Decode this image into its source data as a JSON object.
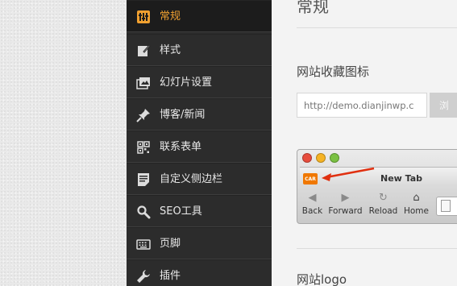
{
  "sidebar": {
    "items": [
      {
        "label": "常规",
        "icon": "general-settings-icon",
        "active": true
      },
      {
        "label": "样式",
        "icon": "edit-icon"
      },
      {
        "label": "幻灯片设置",
        "icon": "slideshow-icon"
      },
      {
        "label": "博客/新闻",
        "icon": "pin-icon"
      },
      {
        "label": "联系表单",
        "icon": "qr-grid-icon"
      },
      {
        "label": "自定义侧边栏",
        "icon": "document-icon"
      },
      {
        "label": "SEO工具",
        "icon": "search-icon"
      },
      {
        "label": "页脚",
        "icon": "keyboard-icon"
      },
      {
        "label": "插件",
        "icon": "wrench-icon"
      }
    ]
  },
  "main": {
    "section_title": "常规",
    "favicon_label": "网站收藏图标",
    "favicon_url_value": "http://demo.dianjinwp.c",
    "browse_label": "浏",
    "preview": {
      "tab_title": "New Tab",
      "favicon_text": "CAR",
      "toolbar": [
        {
          "label": "Back",
          "icon": "back-arrow-icon"
        },
        {
          "label": "Forward",
          "icon": "forward-arrow-icon"
        },
        {
          "label": "Reload",
          "icon": "reload-icon"
        },
        {
          "label": "Home",
          "icon": "home-icon"
        }
      ]
    },
    "logo_label": "网站logo"
  },
  "colors": {
    "sidebar_bg": "#2c2c2c",
    "active_accent": "#f0a030",
    "favicon_orange": "#f07800",
    "arrow_red": "#e03010"
  }
}
